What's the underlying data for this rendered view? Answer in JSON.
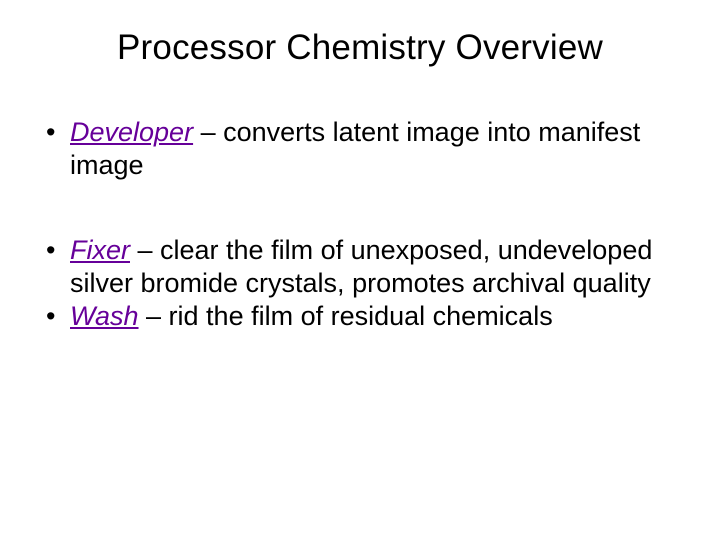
{
  "title": "Processor Chemistry Overview",
  "items": [
    {
      "term": "Developer",
      "desc": " – converts latent image into manifest image"
    },
    {
      "term": "Fixer",
      "desc": " – clear the film of unexposed, undeveloped silver bromide crystals, promotes archival quality"
    },
    {
      "term": "Wash",
      "desc": " – rid the film of residual chemicals"
    }
  ]
}
